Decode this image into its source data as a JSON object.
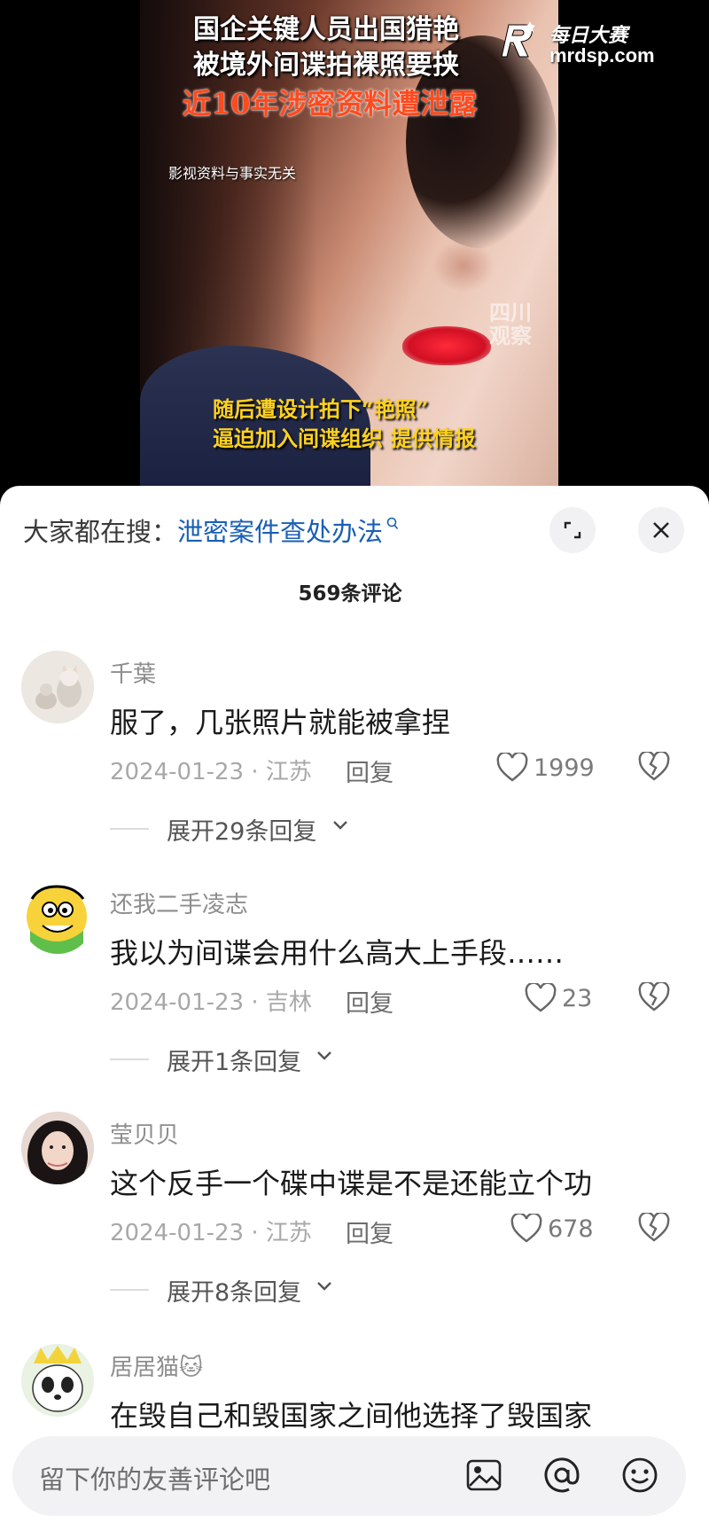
{
  "video": {
    "title_line1": "国企关键人员出国猎艳",
    "title_line2": "被境外间谍拍裸照要挟",
    "title_line3": "近10年涉密资料遭泄露",
    "disclaimer": "影视资料与事实无关",
    "caption_line1": "随后遭设计拍下“艳照”",
    "caption_line2": "逼迫加入间谍组织 提供情报",
    "watermark_center": "四川\n观察",
    "watermark_brand": "每日大赛",
    "watermark_url": "mrdsp.com"
  },
  "search": {
    "prefix": "大家都在搜：",
    "query": "泄密案件查处办法"
  },
  "comments_count": "569条评论",
  "comments": [
    {
      "name": "千葉",
      "text": "服了，几张照片就能被拿捏",
      "meta": "2024-01-23 · 江苏",
      "reply_label": "回复",
      "likes": "1999",
      "expand_label": "展开29条回复"
    },
    {
      "name": "还我二手凌志",
      "text": "我以为间谍会用什么高大上手段……",
      "meta": "2024-01-23 · 吉林",
      "reply_label": "回复",
      "likes": "23",
      "expand_label": "展开1条回复"
    },
    {
      "name": "莹贝贝",
      "text": "这个反手一个碟中谍是不是还能立个功",
      "meta": "2024-01-23 · 江苏",
      "reply_label": "回复",
      "likes": "678",
      "expand_label": "展开8条回复"
    },
    {
      "name": "居居猫🐱",
      "text": "在毁自己和毁国家之间他选择了毁国家"
    }
  ],
  "input": {
    "placeholder": "留下你的友善评论吧"
  },
  "colors": {
    "link": "#1a5fb4",
    "title_red": "#ff4a1e",
    "caption_yellow": "#ffd21e"
  }
}
